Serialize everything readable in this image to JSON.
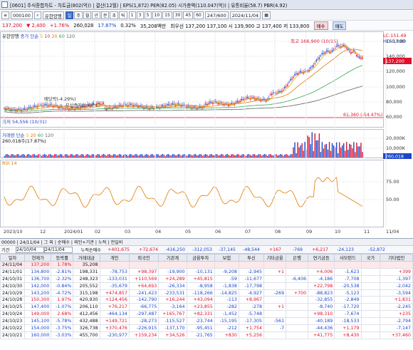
{
  "window": {
    "title": "[0601] 주식종합차트 - 차트금(802(억)) | 결산(12월) | EPS(1,872) PER(82.05) 시가총액(110.047(억)) | 유통비율(58.7) PBR(4.92)"
  },
  "toolbar": {
    "code": "000100",
    "stock_name": "유한양행",
    "period_buttons": [
      "일",
      "주",
      "월",
      "년",
      "분",
      "초",
      "틱"
    ],
    "interval_buttons": [
      "1",
      "3",
      "5",
      "10",
      "15",
      "30",
      "45",
      "60"
    ],
    "count": "247/600",
    "date": "2024/11/04"
  },
  "quote": {
    "price": "137,200",
    "change": "▼ 2,400",
    "change_pct": "+1.76%",
    "volume": "260,028",
    "turnover_pct": "17.87%",
    "ratio": "0.32%",
    "trade_value": "35,208백만",
    "summary": "최우선 137,200 137,100 시 139,900 고 137,400 저 133,800",
    "buy_label": "매수",
    "sell_label": "매도"
  },
  "price_panel": {
    "legend_name": "유한양행",
    "ma_label": "종가 단순",
    "ma_periods": [
      "5",
      "10",
      "20",
      "60",
      "120"
    ],
    "ma_colors": [
      "#e8b000",
      "#c0307c",
      "#e07a00",
      "#34a853",
      "#606060"
    ],
    "high_label": "최고 166,900 (10/15)",
    "low_label": "최저 54,556 (10/31)",
    "lc_label": "LC:151.49",
    "hc_label": "HC:-17.80",
    "last_price_tag": "137,200",
    "annotation_1": "배당락(-4.29%)",
    "annotation_2": "무상증자(0.00%)",
    "ref_line_label": "61,360 (-54.47%)",
    "y_ticks": [
      "160,000",
      "140,000",
      "120,000",
      "100,000",
      "80,000",
      "60,000"
    ]
  },
  "volume_panel": {
    "label": "거래량 단순",
    "ma_periods": [
      "5",
      "20",
      "60",
      "120"
    ],
    "value_label": "260,018주(17.87%)",
    "y_ticks": [
      "20,000K",
      "10,000K"
    ],
    "last_tag": "260,018"
  },
  "rsi_panel": {
    "label": "RSI 14",
    "y_ticks": [
      "75.00",
      "50.00"
    ]
  },
  "x_axis": {
    "labels": [
      "2023/10",
      "12",
      "2024/01",
      "02",
      "03",
      "04",
      "05",
      "06",
      "07",
      "08",
      "09",
      "10",
      "11",
      "11/04"
    ]
  },
  "table": {
    "toolbar": "00000 | 24/11/04 | 그 외 | 순매수 | 외인+기관 | 누적 | 전일비",
    "filter": {
      "period_label": "기간",
      "from": "24/10/04",
      "to": "24/11/04",
      "sum_label": "누적순매수",
      "sums": [
        "+401,675",
        "+72,674",
        "-416,250",
        "-312,053",
        "-37,145",
        "-48,544",
        "+167",
        "-769",
        "+6,217",
        "-24,123",
        "-52,872"
      ]
    },
    "headers": [
      "일자",
      "현재가",
      "등락률",
      "거래대금",
      "개인",
      "외국인",
      "기관계",
      "금융투자",
      "보험",
      "투신",
      "기타금융",
      "은행",
      "연기금등",
      "사모펀드",
      "국가",
      "기타법인"
    ],
    "rows": [
      [
        "24/11/04",
        "137,200",
        "1.78%",
        "35,208",
        "",
        "",
        "",
        "",
        "",
        "",
        "",
        "",
        "",
        "",
        "",
        ""
      ],
      [
        "24/11/01",
        "134,800",
        "-2.81%",
        "198,331",
        "-78,753",
        "+98,397",
        "-19,900",
        "-10,131",
        "-9,208",
        "-2,945",
        "+1",
        "",
        "+4,006",
        "-1,623",
        "",
        "+399"
      ],
      [
        "24/10/31",
        "136,700",
        "-2.32%",
        "248,323",
        "-133,031",
        "+110,569",
        "+24,289",
        "+45,815",
        "-59",
        "-11,677",
        "",
        "-6,406",
        "-4,186",
        "-7,708",
        "",
        "-1,397"
      ],
      [
        "24/10/30",
        "142,000",
        "-0.84%",
        "205,552",
        "-35,679",
        "+64,693",
        "-26,334",
        "-8,958",
        "-1,838",
        "-17,798",
        "",
        "",
        "+22,798",
        "-20,538",
        "",
        "-2,042"
      ],
      [
        "24/10/29",
        "143,200",
        "-4.72%",
        "315,198",
        "+474,857",
        "-241,423",
        "-233,531",
        "-118,266",
        "-14,825",
        "-4,927",
        "-269",
        "+700",
        "-88,823",
        "-5,123",
        "",
        "-3,594"
      ],
      [
        "24/10/28",
        "150,300",
        "1.97%",
        "420,930",
        "+124,456",
        "-142,790",
        "+16,244",
        "+43,094",
        "-113",
        "+8,967",
        "",
        "",
        "-32,855",
        "-2,849",
        "",
        "+1,831"
      ],
      [
        "24/10/25",
        "147,400",
        "-1.07%",
        "206,110",
        "+76,217",
        "-66,775",
        "-3,164",
        "+23,855",
        "-282",
        "-278",
        "+1",
        "",
        "-8,740",
        "-17,720",
        "",
        "-2,245"
      ],
      [
        "24/10/24",
        "149,000",
        "2.68%",
        "412,456",
        "-464,134",
        "-297,487",
        "+165,767",
        "+82,331",
        "-1,452",
        "-5,748",
        "",
        "",
        "+98,310",
        "-7,674",
        "",
        "+235"
      ],
      [
        "24/10/23",
        "145,100",
        "-5.78%",
        "432,488",
        "+149,721",
        "-28,273",
        "-115,527",
        "-23,744",
        "-15,195",
        "-17,305",
        "-561",
        "",
        "-40,189",
        "-18,533",
        "",
        "-2,794"
      ],
      [
        "24/10/22",
        "154,000",
        "-3.75%",
        "326,738",
        "+370,476",
        "-226,915",
        "-137,170",
        "-95,451",
        "-212",
        "+1,754",
        "-7",
        "",
        "-44,436",
        "+1,179",
        "",
        "-7,147"
      ],
      [
        "24/10/21",
        "160,000",
        "-3.03%",
        "455,700",
        "-230,977",
        "+159,234",
        "+34,526",
        "-21,765",
        "+830",
        "+5,256",
        "",
        "",
        "+41,775",
        "+8,430",
        "",
        "+37,460"
      ]
    ]
  },
  "colors": {
    "up": "#e0102a",
    "down": "#1d46c8",
    "ma5": "#e8b000",
    "ma20": "#e07a00",
    "ma60": "#34a853",
    "ma120": "#606060",
    "rsi": "#e07a00"
  }
}
